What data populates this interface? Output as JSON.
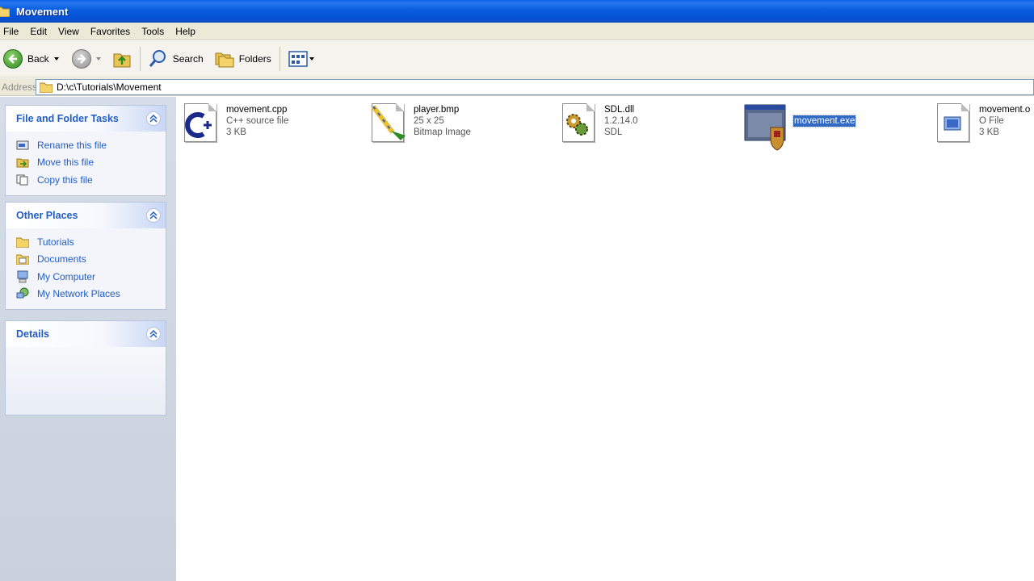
{
  "window": {
    "title": "Movement"
  },
  "menu": [
    "File",
    "Edit",
    "View",
    "Favorites",
    "Tools",
    "Help"
  ],
  "toolbar": {
    "back": "Back",
    "search": "Search",
    "folders": "Folders"
  },
  "address": {
    "label": "Address",
    "path": "D:\\c\\Tutorials\\Movement"
  },
  "tasks": {
    "title": "File and Folder Tasks",
    "items": [
      "Rename this file",
      "Move this file",
      "Copy this file"
    ]
  },
  "places": {
    "title": "Other Places",
    "items": [
      "Tutorials",
      "Documents",
      "My Computer",
      "My Network Places"
    ]
  },
  "details": {
    "title": "Details"
  },
  "files": [
    {
      "name": "movement.cpp",
      "line2": "C++ source file",
      "line3": "3 KB",
      "icon": "cpp-file-icon"
    },
    {
      "name": "player.bmp",
      "line2": "25 x 25",
      "line3": "Bitmap Image",
      "icon": "paint-file-icon"
    },
    {
      "name": "SDL.dll",
      "line2": "1.2.14.0",
      "line3": "SDL",
      "icon": "dll-file-icon"
    },
    {
      "name": "movement.exe",
      "line2": "",
      "line3": "",
      "icon": "exe-file-icon",
      "selected": true
    },
    {
      "name": "movement.o",
      "line2": "O File",
      "line3": "3 KB",
      "icon": "generic-file-icon"
    }
  ],
  "colors": {
    "titlebar": "#0552d6",
    "selection": "#316ac5",
    "link": "#215dc6"
  }
}
